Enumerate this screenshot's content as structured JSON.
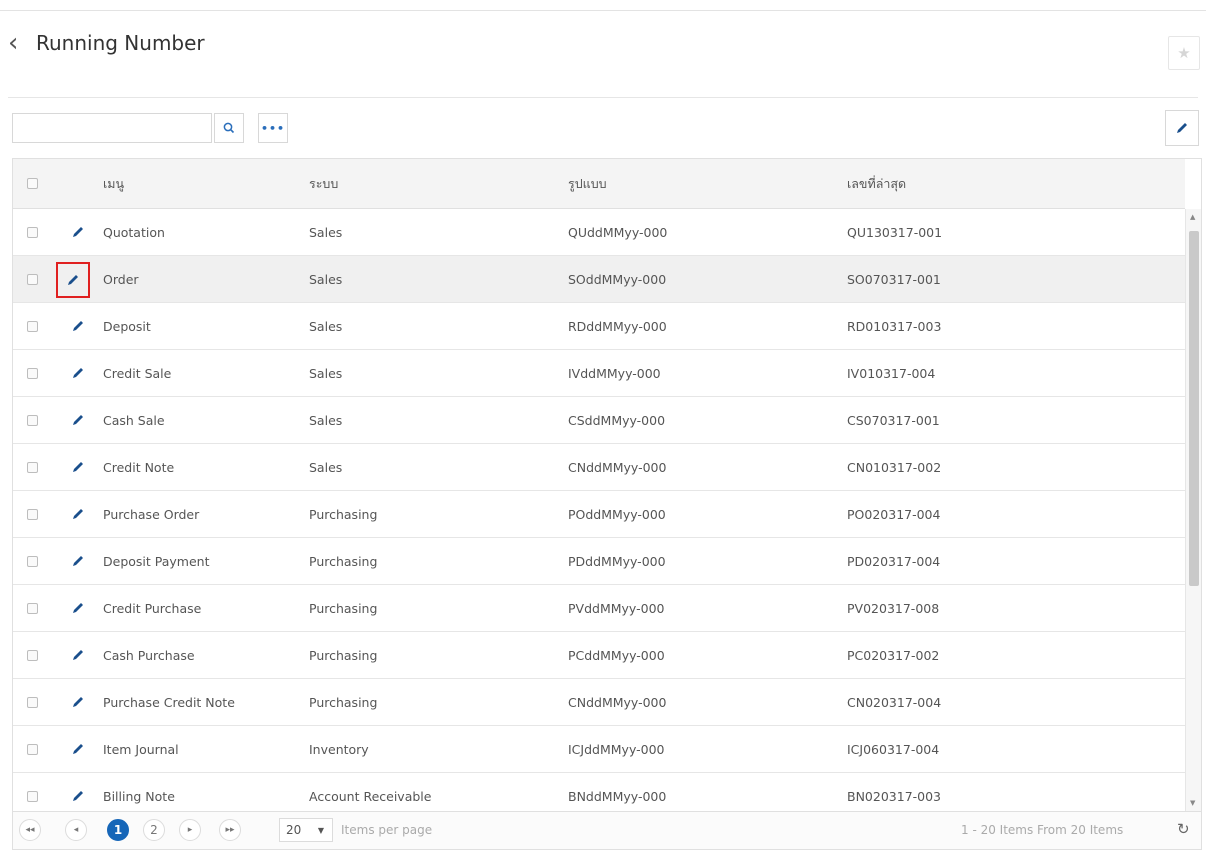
{
  "header": {
    "title": "Running Number"
  },
  "toolbar": {
    "search_placeholder": "",
    "more_label": "•••"
  },
  "columns": {
    "menu": "เมนู",
    "system": "ระบบ",
    "format": "รูปแบบ",
    "latest": "เลขที่ล่าสุด"
  },
  "rows": [
    {
      "menu": "Quotation",
      "system": "Sales",
      "format": "QUddMMyy-000",
      "latest": "QU130317-001"
    },
    {
      "menu": "Order",
      "system": "Sales",
      "format": "SOddMMyy-000",
      "latest": "SO070317-001",
      "selected": true
    },
    {
      "menu": "Deposit",
      "system": "Sales",
      "format": "RDddMMyy-000",
      "latest": "RD010317-003"
    },
    {
      "menu": "Credit Sale",
      "system": "Sales",
      "format": "IVddMMyy-000",
      "latest": "IV010317-004"
    },
    {
      "menu": "Cash Sale",
      "system": "Sales",
      "format": "CSddMMyy-000",
      "latest": "CS070317-001"
    },
    {
      "menu": "Credit Note",
      "system": "Sales",
      "format": "CNddMMyy-000",
      "latest": "CN010317-002"
    },
    {
      "menu": "Purchase Order",
      "system": "Purchasing",
      "format": "POddMMyy-000",
      "latest": "PO020317-004"
    },
    {
      "menu": "Deposit Payment",
      "system": "Purchasing",
      "format": "PDddMMyy-000",
      "latest": "PD020317-004"
    },
    {
      "menu": "Credit Purchase",
      "system": "Purchasing",
      "format": "PVddMMyy-000",
      "latest": "PV020317-008"
    },
    {
      "menu": "Cash Purchase",
      "system": "Purchasing",
      "format": "PCddMMyy-000",
      "latest": "PC020317-002"
    },
    {
      "menu": "Purchase Credit Note",
      "system": "Purchasing",
      "format": "CNddMMyy-000",
      "latest": "CN020317-004"
    },
    {
      "menu": "Item Journal",
      "system": "Inventory",
      "format": "ICJddMMyy-000",
      "latest": "ICJ060317-004"
    },
    {
      "menu": "Billing Note",
      "system": "Account Receivable",
      "format": "BNddMMyy-000",
      "latest": "BN020317-003"
    }
  ],
  "pager": {
    "pages": [
      "1",
      "2"
    ],
    "current_page": "1",
    "first": "◂◂",
    "prev": "◂",
    "next": "▸",
    "last": "▸▸",
    "page_size": "20",
    "items_per_page_label": "Items per page",
    "info": "1 - 20 Items From 20 Items"
  },
  "colors": {
    "accent": "#1666b8",
    "highlight": "#e02020"
  }
}
